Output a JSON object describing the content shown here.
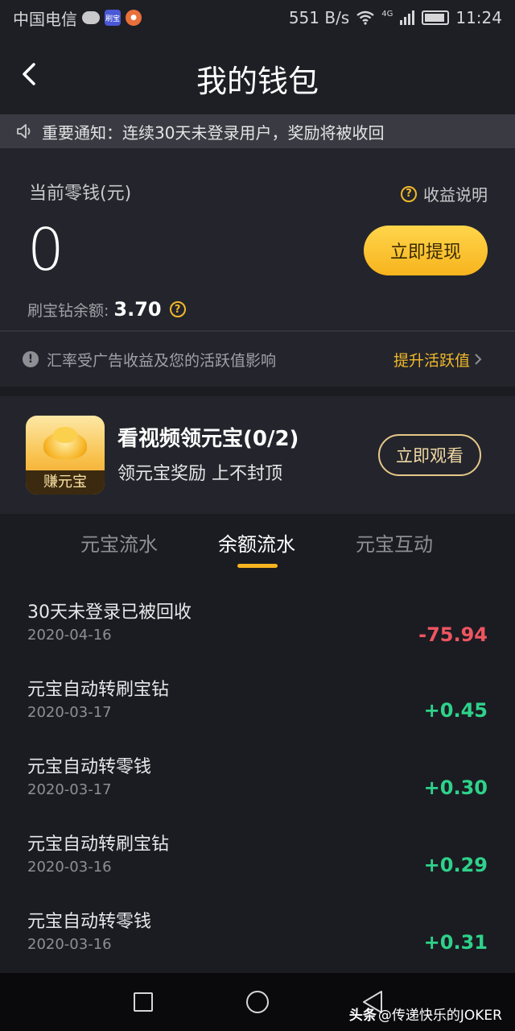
{
  "status_bar": {
    "carrier": "中国电信",
    "app_badge": "刷宝",
    "net_speed": "551 B/s",
    "network": "4G",
    "time": "11:24"
  },
  "header": {
    "title": "我的钱包"
  },
  "notice": {
    "text": "重要通知：连续30天未登录用户，奖励将被收回"
  },
  "wallet": {
    "balance_label": "当前零钱(元)",
    "earnings_explain": "收益说明",
    "balance_value": "0",
    "withdraw_label": "立即提现",
    "diamond_label": "刷宝钻余额:",
    "diamond_value": "3.70",
    "rate_note": "汇率受广告收益及您的活跃值影响",
    "boost_label": "提升活跃值"
  },
  "video_task": {
    "thumb_label": "赚元宝",
    "title": "看视频领元宝(0/2)",
    "subtitle": "领元宝奖励 上不封顶",
    "watch_label": "立即观看"
  },
  "tabs": [
    {
      "label": "元宝流水",
      "active": false
    },
    {
      "label": "余额流水",
      "active": true
    },
    {
      "label": "元宝互动",
      "active": false
    }
  ],
  "records": [
    {
      "title": "30天未登录已被回收",
      "date": "2020-04-16",
      "amount": "-75.94",
      "sign": "negative"
    },
    {
      "title": "元宝自动转刷宝钻",
      "date": "2020-03-17",
      "amount": "+0.45",
      "sign": "positive"
    },
    {
      "title": "元宝自动转零钱",
      "date": "2020-03-17",
      "amount": "+0.30",
      "sign": "positive"
    },
    {
      "title": "元宝自动转刷宝钻",
      "date": "2020-03-16",
      "amount": "+0.29",
      "sign": "positive"
    },
    {
      "title": "元宝自动转零钱",
      "date": "2020-03-16",
      "amount": "+0.31",
      "sign": "positive"
    }
  ],
  "watermark": {
    "brand": "头条",
    "handle": "@传递快乐的JOKER"
  },
  "colors": {
    "accent": "#f7b41e",
    "negative": "#ef5560",
    "positive": "#2ed28a",
    "background": "#1b1c22"
  }
}
